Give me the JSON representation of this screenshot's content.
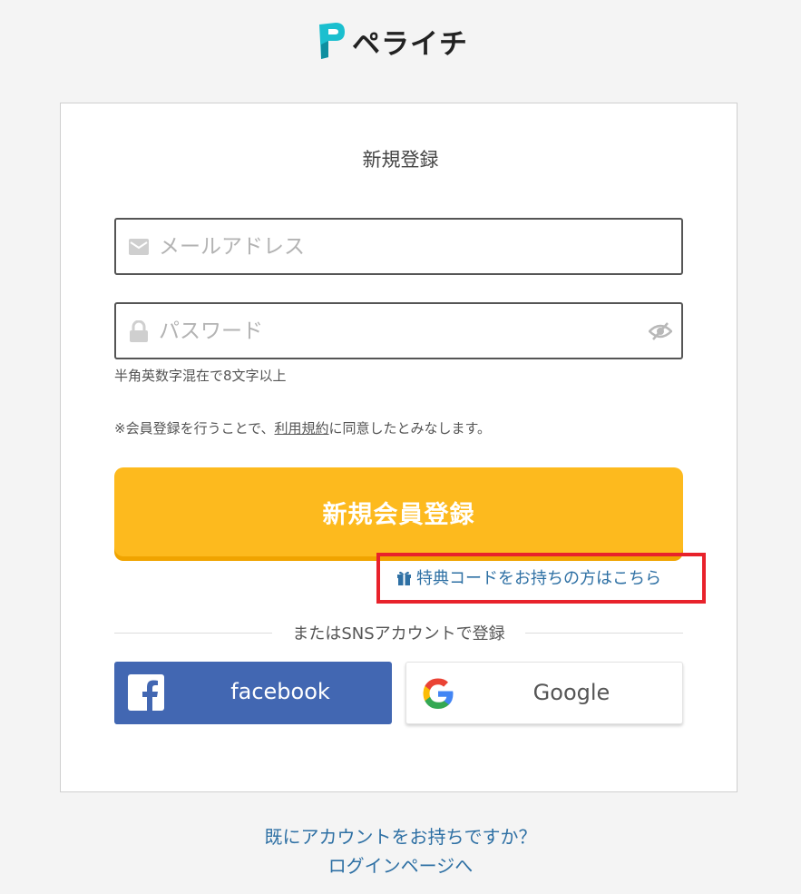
{
  "brand": {
    "name": "ペライチ",
    "accent_color": "#1bbfcf",
    "logo_icon": "perai-p-logo-icon"
  },
  "form": {
    "title": "新規登録",
    "email": {
      "placeholder": "メールアドレス",
      "icon": "envelope-icon"
    },
    "password": {
      "placeholder": "パスワード",
      "icon": "lock-icon",
      "toggle_icon": "eye-slash-icon",
      "hint": "半角英数字混在で8文字以上"
    },
    "terms": {
      "prefix": "※会員登録を行うことで、",
      "link": "利用規約",
      "suffix": "に同意したとみなします。"
    },
    "submit_label": "新規会員登録",
    "submit_color": "#fdba1e",
    "promo": {
      "label": "特典コードをお持ちの方はこちら",
      "icon": "gift-icon",
      "highlight_color": "#e8222b"
    },
    "divider_label": "またはSNSアカウントで登録",
    "sns": {
      "facebook": {
        "label": "facebook",
        "icon": "facebook-icon",
        "color": "#4267b2"
      },
      "google": {
        "label": "Google",
        "icon": "google-icon"
      }
    }
  },
  "footer": {
    "question": "既にアカウントをお持ちですか？",
    "login_link": "ログインページへ",
    "link_color": "#2e70a4"
  }
}
